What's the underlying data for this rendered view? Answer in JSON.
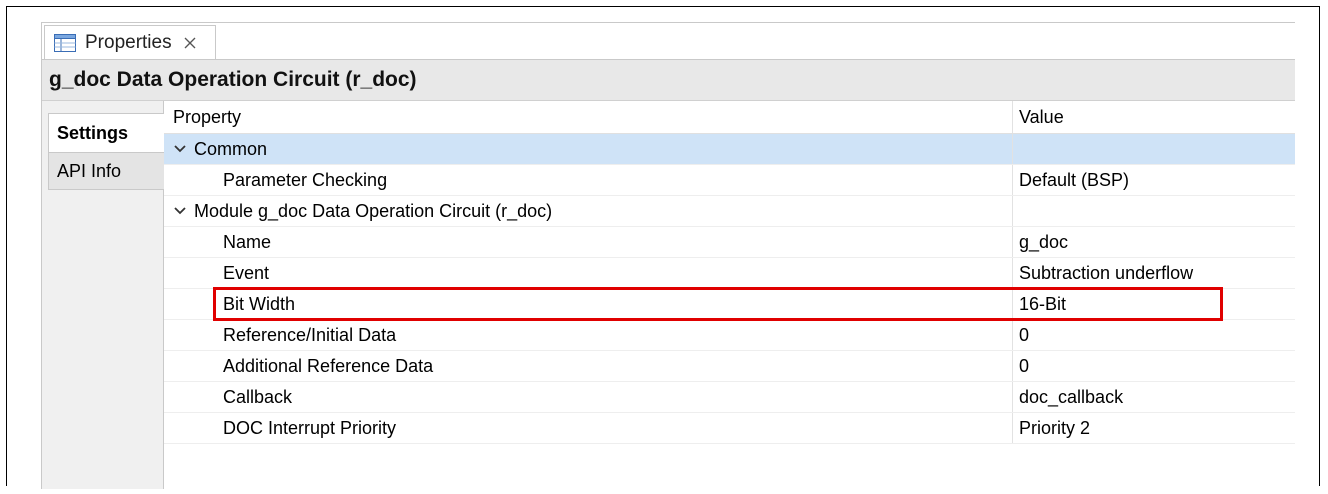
{
  "tab": {
    "label": "Properties"
  },
  "title": "g_doc Data Operation Circuit (r_doc)",
  "sidetabs": {
    "settings": "Settings",
    "api_info": "API Info"
  },
  "table": {
    "headers": {
      "property": "Property",
      "value": "Value"
    },
    "rows": [
      {
        "property": "Common",
        "value": ""
      },
      {
        "property": "Parameter Checking",
        "value": "Default (BSP)"
      },
      {
        "property": "Module g_doc Data Operation Circuit (r_doc)",
        "value": ""
      },
      {
        "property": "Name",
        "value": "g_doc"
      },
      {
        "property": "Event",
        "value": "Subtraction underflow"
      },
      {
        "property": "Bit Width",
        "value": "16-Bit"
      },
      {
        "property": "Reference/Initial Data",
        "value": "0"
      },
      {
        "property": "Additional Reference Data",
        "value": "0"
      },
      {
        "property": "Callback",
        "value": "doc_callback"
      },
      {
        "property": "DOC Interrupt Priority",
        "value": "Priority 2"
      }
    ]
  },
  "colors": {
    "highlight": "#e00000",
    "selected_row": "#cfe3f7",
    "title_bar": "#e8e8e8"
  },
  "icons": {
    "tab": "properties-table-icon",
    "close": "close-icon",
    "expand": "chevron-down-icon"
  }
}
